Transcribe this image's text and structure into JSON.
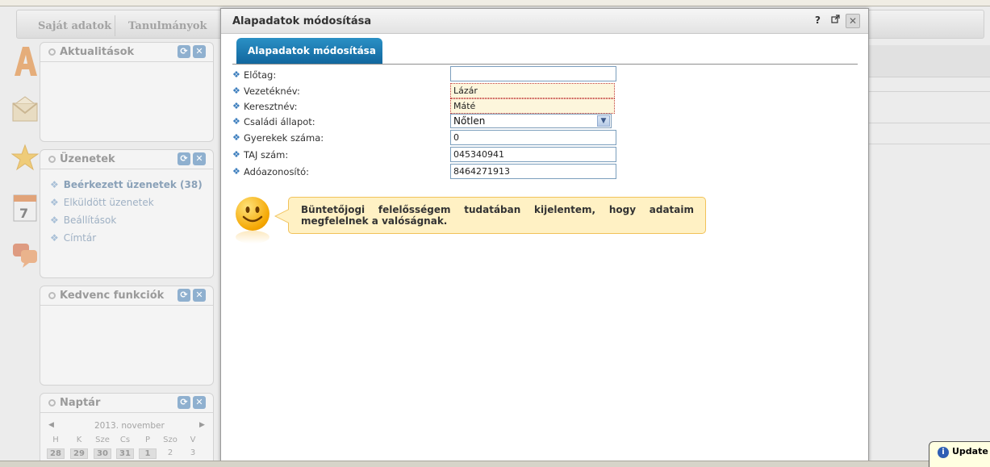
{
  "background": {
    "top_tabs": [
      "Saját adatok",
      "Tanulmányok"
    ],
    "boxes": {
      "aktualitasok": {
        "title": "Aktualitások"
      },
      "uzenetek": {
        "title": "Üzenetek",
        "items": [
          "Beérkezett üzenetek (38)",
          "Elküldött üzenetek",
          "Beállítások",
          "Címtár"
        ]
      },
      "kedvenc": {
        "title": "Kedvenc funkciók"
      },
      "naptar": {
        "title": "Naptár",
        "month": "2013. november",
        "weekdays": [
          "H",
          "K",
          "Sze",
          "Cs",
          "P",
          "Szo",
          "V"
        ],
        "days": [
          "28",
          "29",
          "30",
          "31",
          "1",
          "2",
          "3"
        ]
      }
    },
    "side_icons": [
      "letter-a-icon",
      "envelope-icon",
      "star-icon",
      "calendar-icon",
      "chat-icon"
    ],
    "calendar_icon_number": "7"
  },
  "modal": {
    "title": "Alapadatok módosítása",
    "help": "?",
    "close": "✕",
    "tab_label": "Alapadatok módosítása",
    "fields": {
      "elotag": {
        "label": "Előtag:",
        "value": ""
      },
      "vezeteknev": {
        "label": "Vezetéknév:",
        "value": "Lázár"
      },
      "keresztnev": {
        "label": "Keresztnév:",
        "value": "Máté"
      },
      "csaladi_allapot": {
        "label": "Családi állapot:",
        "value": "Nőtlen"
      },
      "gyerekek": {
        "label": "Gyerekek száma:",
        "value": "0"
      },
      "taj": {
        "label": "TAJ szám:",
        "value": "045340941"
      },
      "adoazonosito": {
        "label": "Adóazonosító:",
        "value": "8464271913"
      }
    },
    "declaration": "Büntetőjogi felelősségem tudatában kijelentem, hogy adataim megfelelnek a valóságnak."
  },
  "notification": {
    "text": "Update"
  },
  "colors": {
    "accent": "#1a78b1",
    "required_bg": "#fdf6dc",
    "bubble_bg": "#fff1c4"
  }
}
